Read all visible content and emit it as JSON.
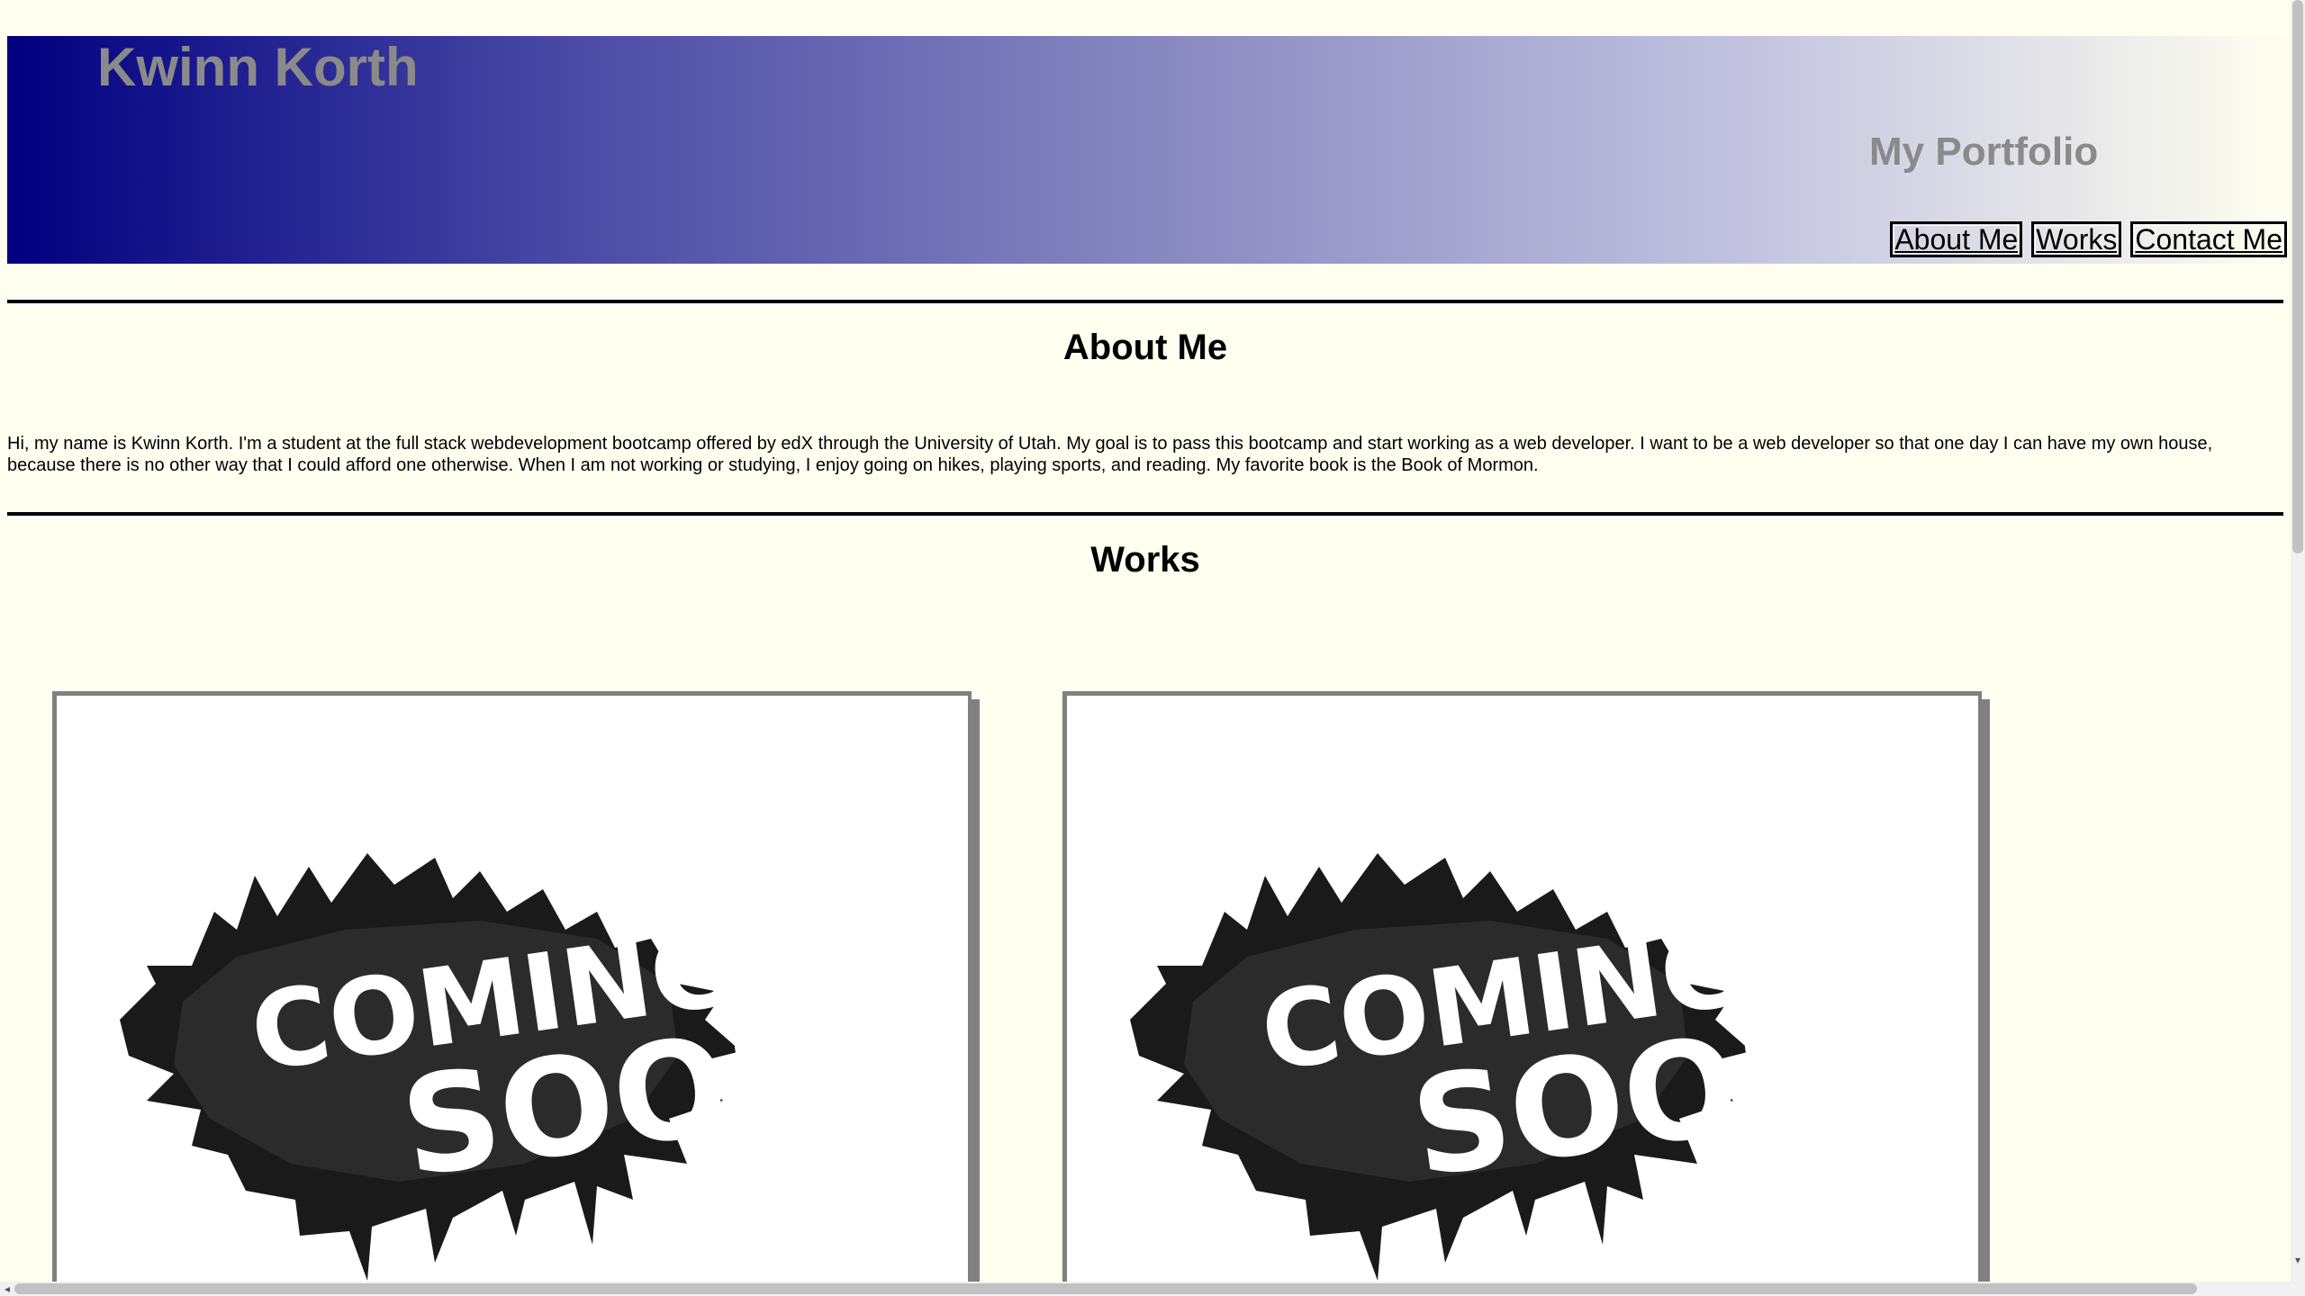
{
  "header": {
    "name": "Kwinn Korth",
    "tagline": "My Portfolio",
    "gradient_start": "#000080",
    "gradient_end": "#fffff0",
    "nav": [
      {
        "label": "About Me"
      },
      {
        "label": "Works"
      },
      {
        "label": "Contact Me"
      }
    ]
  },
  "about": {
    "title": "About Me",
    "text": "Hi, my name is Kwinn Korth. I'm a student at the full stack webdevelopment bootcamp offered by edX through the University of Utah. My goal is to pass this bootcamp and start working as a web developer. I want to be a web developer so that one day I can have my own house, because there is no other way that I could afford one otherwise. When I am not working or studying, I enjoy going on hikes, playing sports, and reading. My favorite book is the Book of Mormon."
  },
  "works": {
    "title": "Works",
    "items": [
      {
        "image": "coming-soon-image",
        "line1": "COMING",
        "line2": "SOON"
      },
      {
        "image": "coming-soon-image",
        "line1": "COMING",
        "line2": "SOON"
      }
    ]
  },
  "colors": {
    "page_background": "#fffff0",
    "heading_gray": "#8a8a8a",
    "card_border": "#808080"
  }
}
